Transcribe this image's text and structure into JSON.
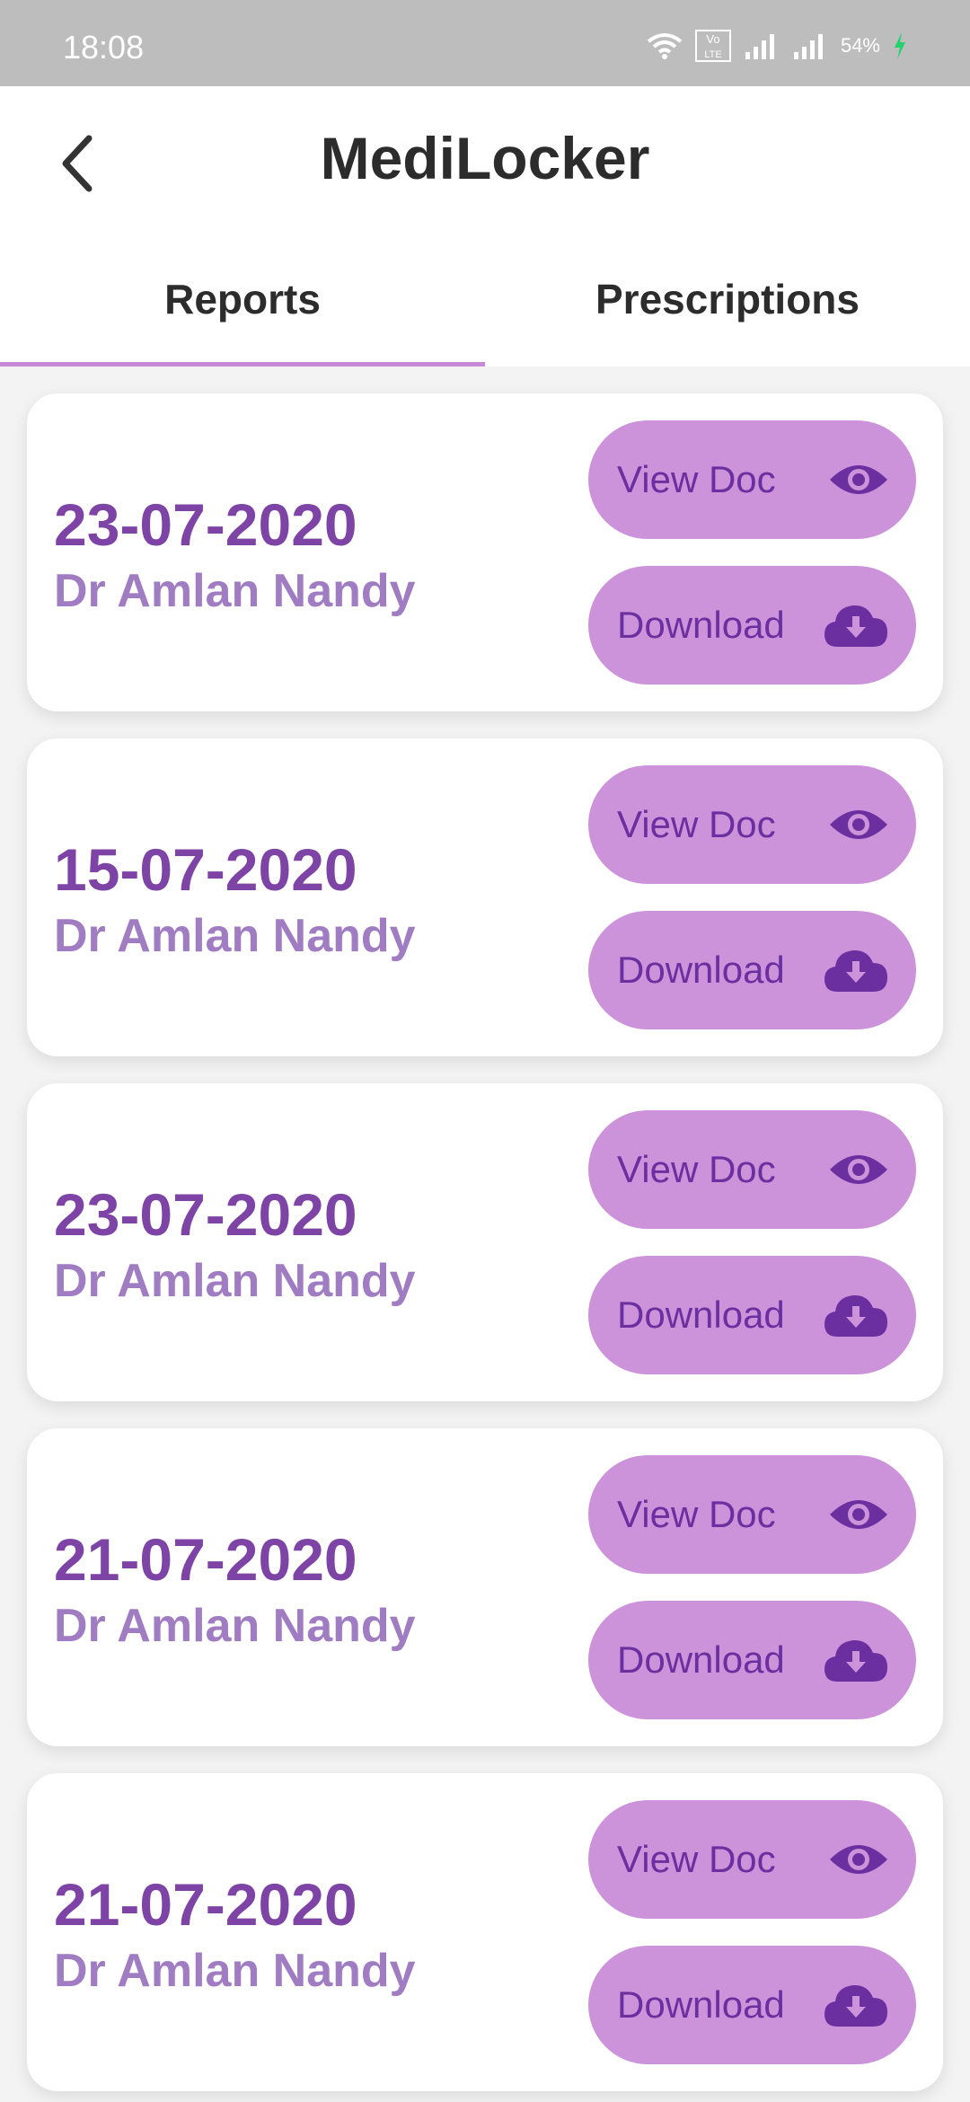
{
  "status_bar": {
    "time": "18:08",
    "battery": "54%",
    "network_label": "Vo LTE2"
  },
  "header": {
    "title": "MediLocker",
    "back_icon": "chevron-left-icon"
  },
  "tabs": [
    {
      "label": "Reports",
      "active": true
    },
    {
      "label": "Prescriptions",
      "active": false
    }
  ],
  "reports": [
    {
      "date": "23-07-2020",
      "doctor": "Dr Amlan Nandy",
      "view_label": "View Doc",
      "download_label": "Download"
    },
    {
      "date": "15-07-2020",
      "doctor": "Dr Amlan Nandy",
      "view_label": "View Doc",
      "download_label": "Download"
    },
    {
      "date": "23-07-2020",
      "doctor": "Dr Amlan Nandy",
      "view_label": "View Doc",
      "download_label": "Download"
    },
    {
      "date": "21-07-2020",
      "doctor": "Dr Amlan Nandy",
      "view_label": "View Doc",
      "download_label": "Download"
    },
    {
      "date": "21-07-2020",
      "doctor": "Dr Amlan Nandy",
      "view_label": "View Doc",
      "download_label": "Download"
    }
  ],
  "colors": {
    "accent": "#cc92da",
    "date_text": "#7d44a6",
    "doctor_text": "#a07cc2",
    "button_text": "#6b2fa0"
  }
}
